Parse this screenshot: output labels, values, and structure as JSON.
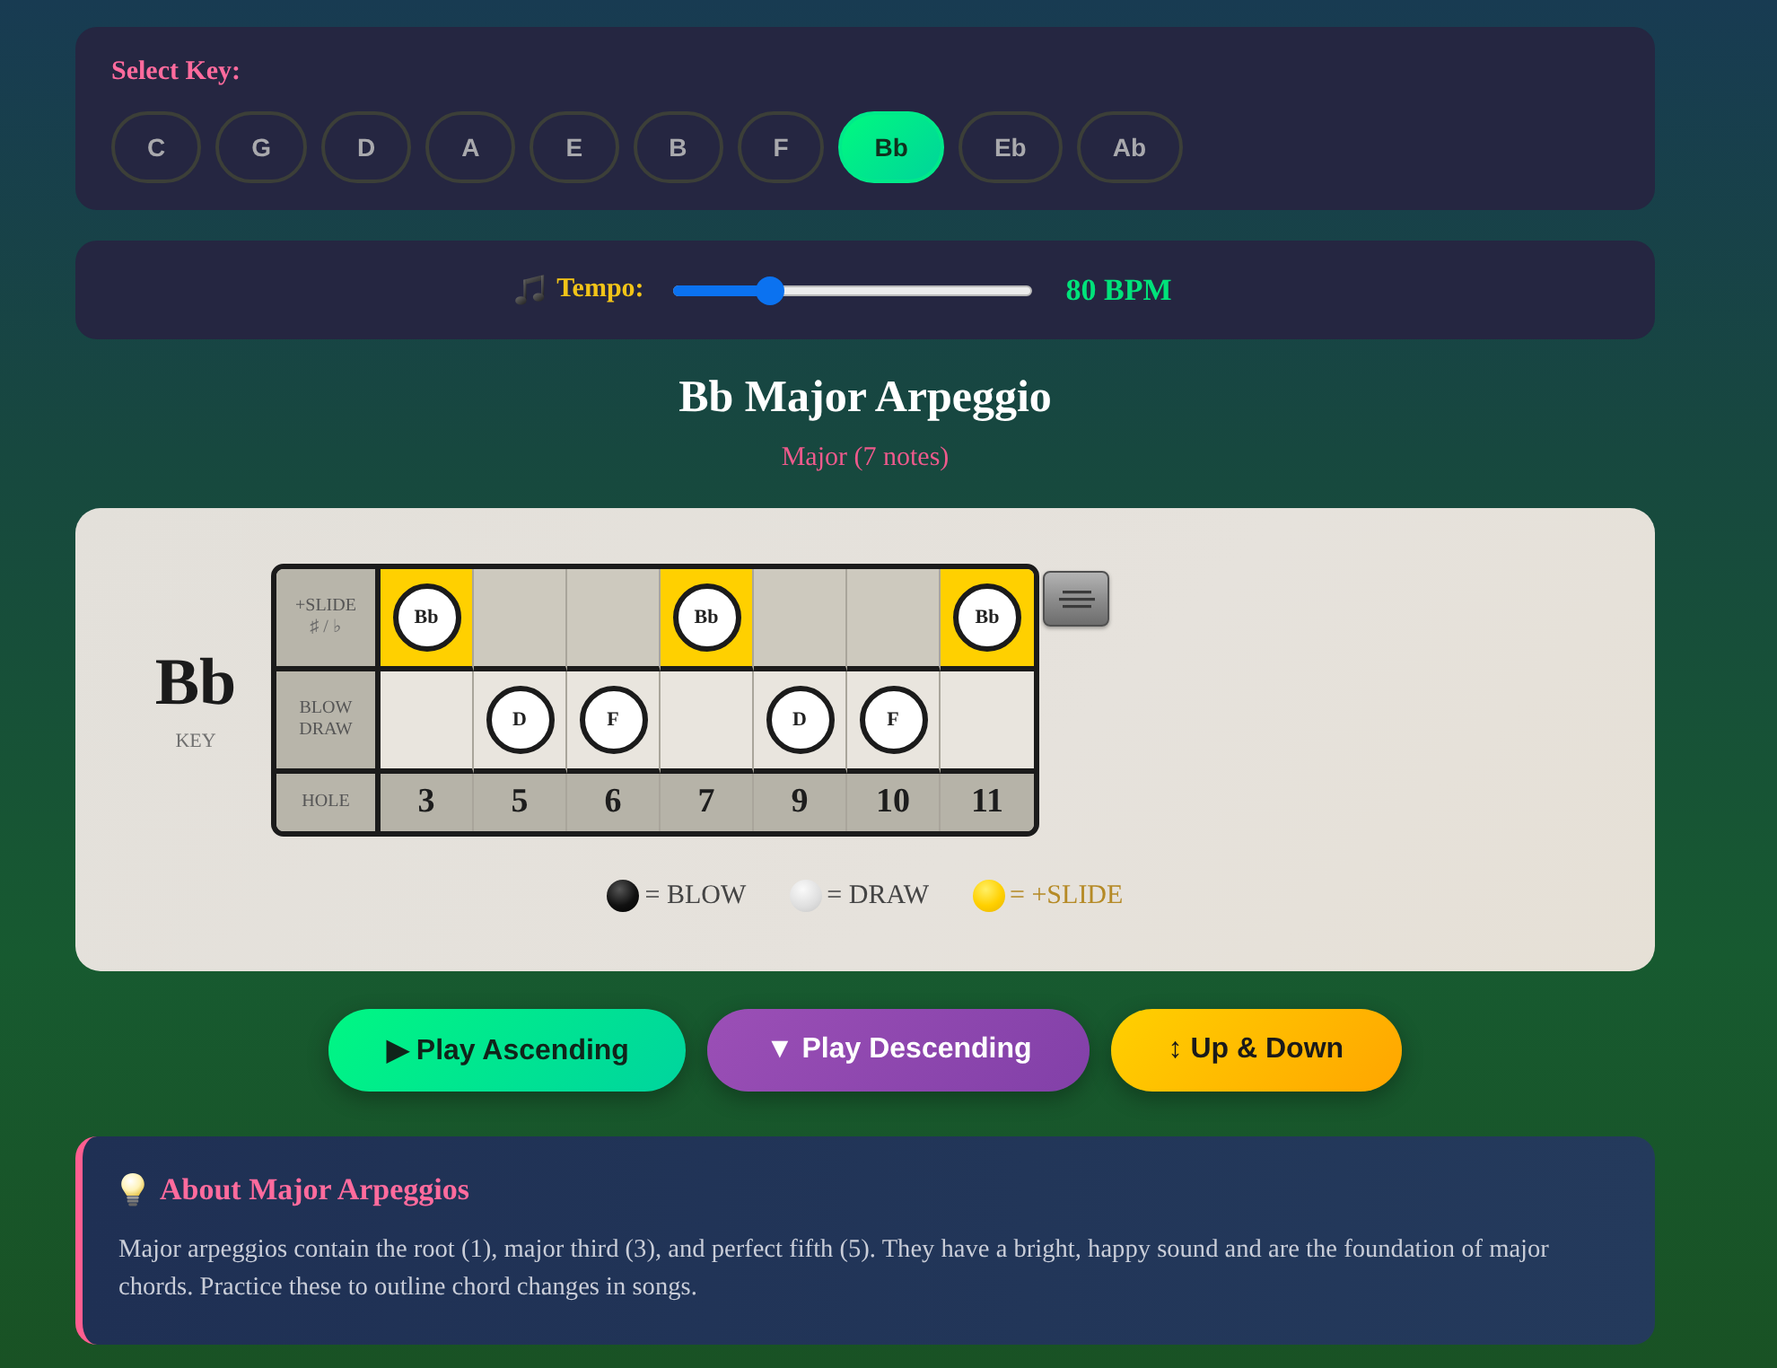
{
  "key_selector": {
    "label": "Select Key:",
    "keys": [
      {
        "label": "C",
        "selected": false
      },
      {
        "label": "G",
        "selected": false
      },
      {
        "label": "D",
        "selected": false
      },
      {
        "label": "A",
        "selected": false
      },
      {
        "label": "E",
        "selected": false
      },
      {
        "label": "B",
        "selected": false
      },
      {
        "label": "F",
        "selected": false
      },
      {
        "label": "Bb",
        "selected": true
      },
      {
        "label": "Eb",
        "selected": false
      },
      {
        "label": "Ab",
        "selected": false
      }
    ]
  },
  "tempo": {
    "label": "Tempo:",
    "level": 0.25,
    "reading": "80 BPM"
  },
  "scale": {
    "title": "Bb Major Arpeggio",
    "subtitle": "Major (7 notes)"
  },
  "harmonica": {
    "key": "Bb",
    "key_caption": "KEY",
    "row_headers": [
      {
        "kind": "slide",
        "label": "+SLIDE",
        "sublabel": "♯ / ♭"
      },
      {
        "kind": "notes",
        "label": "BLOW DRAW"
      },
      {
        "kind": "hole",
        "label": "HOLE"
      }
    ],
    "columns": [
      {
        "hole": "3",
        "slide_note": "Bb"
      },
      {
        "hole": "5",
        "note": "D"
      },
      {
        "hole": "6",
        "note": "F"
      },
      {
        "hole": "7",
        "slide_note": "Bb"
      },
      {
        "hole": "9",
        "note": "D"
      },
      {
        "hole": "10",
        "note": "F"
      },
      {
        "hole": "11",
        "slide_note": "Bb"
      }
    ],
    "legend": [
      {
        "kind": "blow",
        "label": "= BLOW"
      },
      {
        "kind": "draw",
        "label": "= DRAW"
      },
      {
        "kind": "slide",
        "label": "= +SLIDE"
      }
    ]
  },
  "play_buttons": [
    {
      "kind": "ascending",
      "label": "▶ Play Ascending"
    },
    {
      "kind": "descending",
      "label": "▼ Play Descending"
    },
    {
      "kind": "both",
      "label": "↕ Up & Down"
    }
  ],
  "about": {
    "title": "About Major Arpeggios",
    "text": "Major arpeggios contain the root (1), major third (3), and perfect fifth (5). They have a bright, happy sound and are the foundation of major chords. Practice these to outline chord changes in songs."
  }
}
